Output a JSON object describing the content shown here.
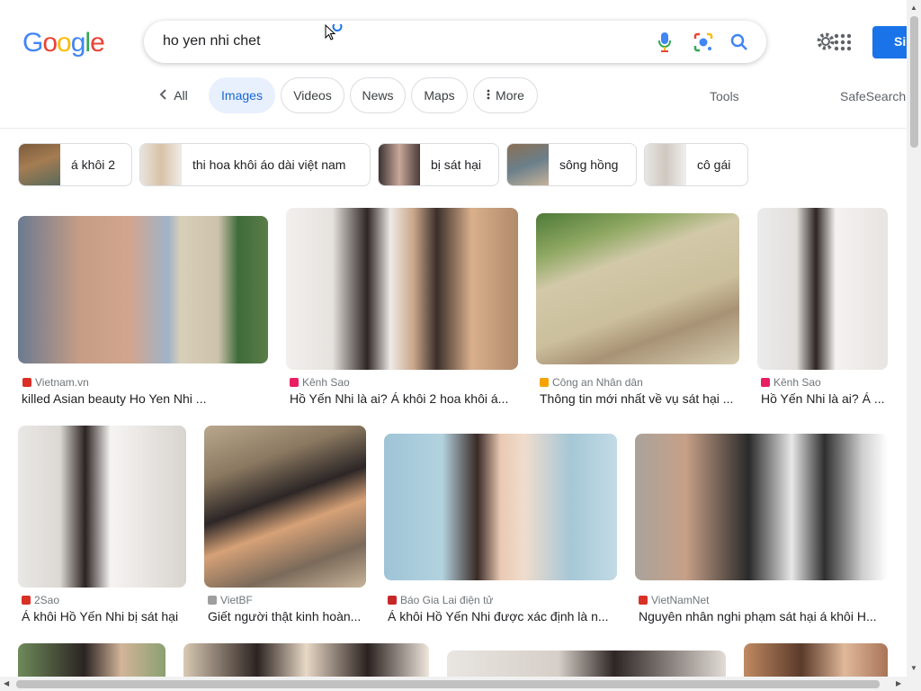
{
  "logo": {
    "letters": [
      "G",
      "o",
      "o",
      "g",
      "l",
      "e"
    ],
    "colors": [
      "#4285f4",
      "#ea4335",
      "#fbbc05",
      "#4285f4",
      "#34a853",
      "#ea4335"
    ]
  },
  "search": {
    "query": "ho yen nhi chet",
    "icons": [
      "mic-icon",
      "lens-icon",
      "search-icon"
    ]
  },
  "header": {
    "signin_label": "Si"
  },
  "tabs": {
    "back_label": "All",
    "items": [
      "Images",
      "Videos",
      "News",
      "Maps",
      "More"
    ],
    "active": "Images",
    "tools_label": "Tools",
    "safesearch_label": "SafeSearch"
  },
  "chips": [
    {
      "label": "á khôi 2"
    },
    {
      "label": "thi hoa khôi áo dài việt nam"
    },
    {
      "label": "bị sát hại"
    },
    {
      "label": "sông hồng"
    },
    {
      "label": "cô gái"
    }
  ],
  "results": [
    {
      "source": "Vietnam.vn",
      "title": "killed Asian beauty Ho Yen Nhi ...",
      "fav_color": "#d93025"
    },
    {
      "source": "Kênh Sao",
      "title": "Hồ Yến Nhi là ai? Á khôi 2 hoa khôi á...",
      "fav_color": "#e91e63"
    },
    {
      "source": "Công an Nhân dân",
      "title": "Thông tin mới nhất về vụ sát hại ...",
      "fav_color": "#f4a300"
    },
    {
      "source": "Kênh Sao",
      "title": "Hồ Yến Nhi là ai? Á ...",
      "fav_color": "#e91e63"
    },
    {
      "source": "2Sao",
      "title": "Á khôi Hồ Yến Nhi bị sát hại",
      "fav_color": "#d93025"
    },
    {
      "source": "VietBF",
      "title": "Giết người thật kinh hoàn...",
      "fav_color": "#9e9e9e"
    },
    {
      "source": "Báo Gia Lai điện tử",
      "title": "Á khôi Hồ Yến Nhi được xác định là n...",
      "fav_color": "#c62828"
    },
    {
      "source": "VietNamNet",
      "title": "Nguyên nhân nghi phạm sát hại á khôi H...",
      "fav_color": "#d93025"
    }
  ]
}
